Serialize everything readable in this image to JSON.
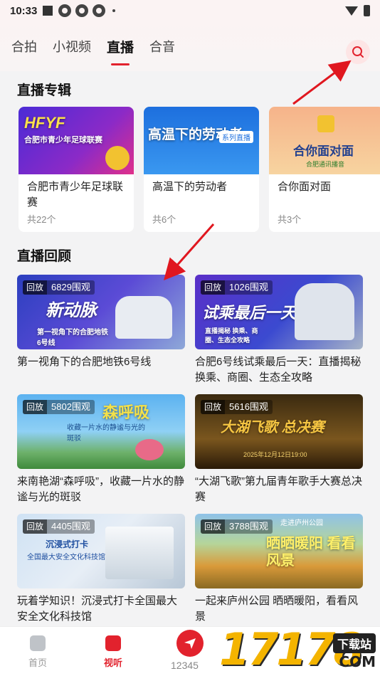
{
  "status_bar": {
    "time": "10:33"
  },
  "top_tabs": [
    "合拍",
    "小视频",
    "直播",
    "合音"
  ],
  "active_tab_index": 2,
  "sections": {
    "albums_title": "直播专辑",
    "replay_title": "直播回顾"
  },
  "albums": [
    {
      "thumb_text": "HFYF",
      "thumb_sub": "合肥市青少年足球联赛",
      "name": "合肥市青少年足球联赛",
      "count": "共22个"
    },
    {
      "thumb_text": "高温下的劳动者",
      "thumb_sub": "系列直播",
      "name": "高温下的劳动者",
      "count": "共6个"
    },
    {
      "thumb_text": "合你面对面",
      "thumb_sub": "合肥通讯播音",
      "name": "合你面对面",
      "count": "共3个"
    }
  ],
  "replays": [
    {
      "tag": "回放",
      "views": "6829围观",
      "thumb_text": "新动脉",
      "thumb_sub": "第一视角下的合肥地铁6号线",
      "caption": "第一视角下的合肥地铁6号线"
    },
    {
      "tag": "回放",
      "views": "1026围观",
      "thumb_text": "试乘最后一天",
      "thumb_sub": "直播揭秘 换乘、商圈、生态全攻略",
      "caption": "合肥6号线试乘最后一天：直播揭秘换乘、商圈、生态全攻略"
    },
    {
      "tag": "回放",
      "views": "5802围观",
      "thumb_text": "森呼吸",
      "thumb_sub": "收藏一片水的静谧与光的斑驳",
      "caption": "来南艳湖“森呼吸”，收藏一片水的静谧与光的斑驳"
    },
    {
      "tag": "回放",
      "views": "5616围观",
      "thumb_text": "大湖飞歌 总决赛",
      "thumb_sub": "2025年12月12日19:00",
      "caption": "“大湖飞歌”第九届青年歌手大赛总决赛"
    },
    {
      "tag": "回放",
      "views": "4405围观",
      "thumb_text": "沉浸式打卡",
      "thumb_sub": "全国最大安全文化科技馆",
      "caption": "玩着学知识！沉浸式打卡全国最大安全文化科技馆"
    },
    {
      "tag": "回放",
      "views": "3788围观",
      "thumb_text": "晒晒暖阳 看看风景",
      "thumb_sub": "走进庐州公园",
      "caption": "一起来庐州公园 晒晒暖阳，看看风景"
    }
  ],
  "bottom_nav": {
    "home": "首页",
    "listen": "视听",
    "center": "12345"
  },
  "watermark": {
    "number": "17178",
    "label": "下载站",
    "suffix": "COM"
  },
  "colors": {
    "accent": "#e2222d",
    "album1": "#6a2fd1",
    "album2": "#1e7be0",
    "album3": "#f3a36f"
  }
}
